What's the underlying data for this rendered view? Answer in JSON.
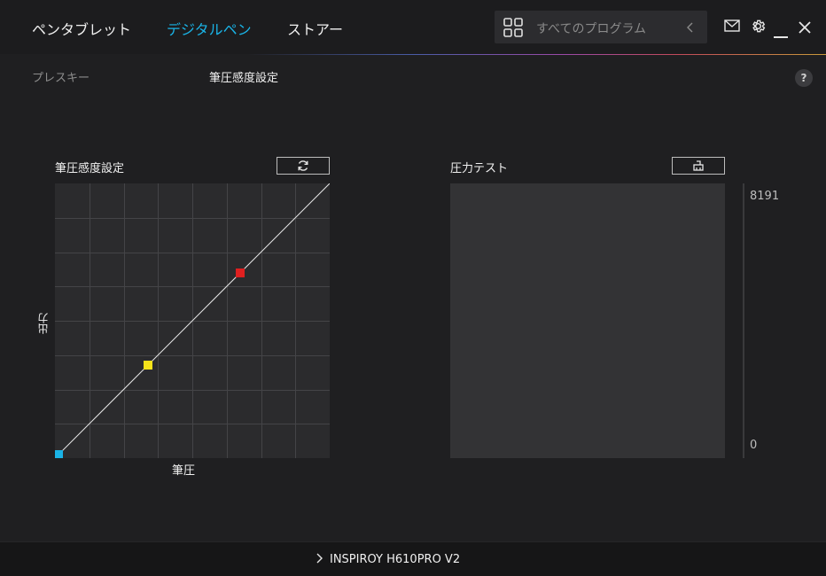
{
  "nav": {
    "tabs": [
      {
        "label": "ペンタブレット",
        "active": false
      },
      {
        "label": "デジタルペン",
        "active": true
      },
      {
        "label": "ストアー",
        "active": false
      }
    ]
  },
  "search": {
    "placeholder": "すべてのプログラム"
  },
  "window": {
    "icons": [
      "mail-icon",
      "gear-icon",
      "minimize-icon",
      "close-icon"
    ]
  },
  "subtabs": {
    "press_keys": "プレスキー",
    "pressure_sensitivity": "筆圧感度設定"
  },
  "help": {
    "label": "?"
  },
  "curve_panel": {
    "title": "筆圧感度設定",
    "y_label": "出力",
    "x_label": "筆圧",
    "reset_icon": "refresh-icon",
    "control_points": [
      {
        "id": "start",
        "pressure": 0.0,
        "output": 0.0,
        "color": "#1ab3e6"
      },
      {
        "id": "mid",
        "pressure": 0.33,
        "output": 0.33,
        "color": "#f5e31a"
      },
      {
        "id": "end-handle",
        "pressure": 0.67,
        "output": 0.67,
        "color": "#e02020"
      }
    ]
  },
  "test_panel": {
    "title": "圧力テスト",
    "clear_icon": "eraser-icon",
    "meter_max": "8191",
    "meter_min": "0",
    "current_pressure": 0
  },
  "device": {
    "name": "INSPIROY H610PRO V2"
  },
  "colors": {
    "accent": "#1ab3e6",
    "background": "#1f1f21"
  }
}
